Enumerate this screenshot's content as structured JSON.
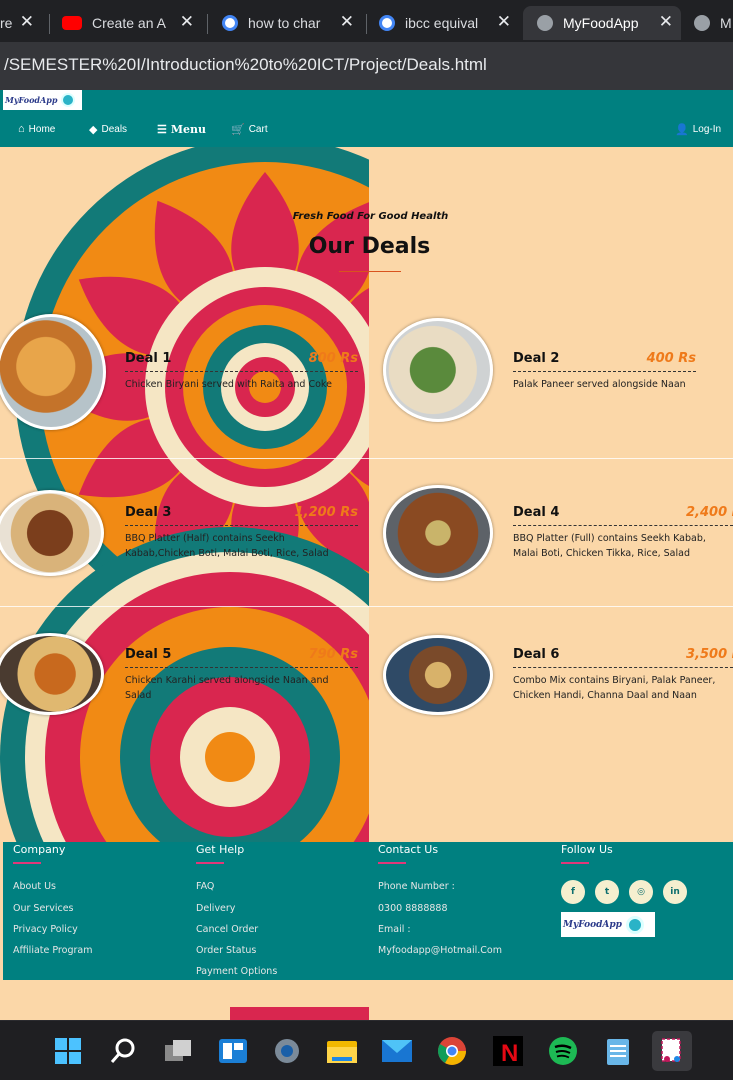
{
  "browser": {
    "tabs": [
      {
        "title": "re",
        "favicon": "generic-icon"
      },
      {
        "title": "Create an A",
        "favicon": "youtube-icon"
      },
      {
        "title": "how to char",
        "favicon": "google-icon"
      },
      {
        "title": "ibcc equival",
        "favicon": "google-icon"
      },
      {
        "title": "MyFoodApp",
        "favicon": "globe-icon"
      },
      {
        "title": "M",
        "favicon": "globe-icon"
      }
    ],
    "close_glyph": "✕",
    "address": "/SEMESTER%20I/Introduction%20to%20ICT/Project/Deals.html"
  },
  "site": {
    "logo_text": "MyFoodApp",
    "nav": {
      "home": "Home",
      "deals": "Deals",
      "menu": "Menu",
      "cart": "Cart",
      "login": "Log-In"
    },
    "heading": {
      "subtitle": "Fresh Food For Good Health",
      "title": "Our Deals"
    },
    "deals": [
      {
        "name": "Deal 1",
        "price": "800 Rs",
        "desc": "Chicken Biryani served with Raita and Coke"
      },
      {
        "name": "Deal 2",
        "price": "400 Rs",
        "desc": "Palak Paneer served alongside Naan"
      },
      {
        "name": "Deal 3",
        "price": "1,200 Rs",
        "desc": "BBQ Platter (Half) contains Seekh Kabab,Chicken Boti, Malai Boti, Rice, Salad"
      },
      {
        "name": "Deal 4",
        "price": "2,400 Rs",
        "desc": "BBQ Platter (Full) contains Seekh Kabab, Malai Boti, Chicken Tikka, Rice, Salad"
      },
      {
        "name": "Deal 5",
        "price": "790 Rs",
        "desc": "Chicken Karahi served alongside Naan and Salad"
      },
      {
        "name": "Deal 6",
        "price": "3,500 Rs",
        "desc": "Combo Mix contains Biryani, Palak Paneer, Chicken Handi, Channa Daal and Naan"
      }
    ],
    "footer": {
      "company": {
        "heading": "Company",
        "links": [
          "About Us",
          "Our Services",
          "Privacy Policy",
          "Affiliate Program"
        ]
      },
      "help": {
        "heading": "Get Help",
        "links": [
          "FAQ",
          "Delivery",
          "Cancel Order",
          "Order Status",
          "Payment Options"
        ]
      },
      "contact": {
        "heading": "Contact Us",
        "lines": [
          "Phone Number :",
          "0300 8888888",
          "Email :",
          "Myfoodapp@Hotmail.Com"
        ]
      },
      "follow": {
        "heading": "Follow Us",
        "socials": [
          "facebook-icon",
          "twitter-icon",
          "instagram-icon",
          "linkedin-icon"
        ]
      }
    }
  },
  "colors": {
    "teal": "#008080",
    "page_bg": "#fbd7a8",
    "price_orange": "#ef7a1a",
    "accent_pink": "#e0387a"
  },
  "taskbar": {
    "icons": [
      "windows-start-icon",
      "search-icon",
      "task-view-icon",
      "widgets-icon",
      "settings-icon",
      "file-explorer-icon",
      "mail-icon",
      "chrome-icon",
      "netflix-icon",
      "spotify-icon",
      "notepad-icon",
      "snipping-tool-icon"
    ]
  }
}
